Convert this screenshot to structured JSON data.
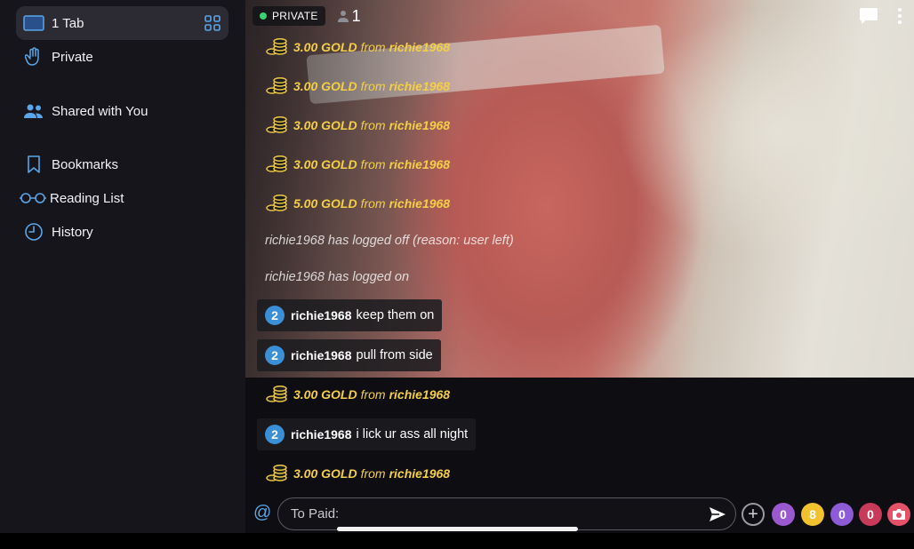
{
  "sidebar": {
    "items": [
      {
        "label": "1 Tab",
        "icon": "tab-overview-icon"
      },
      {
        "label": "Private",
        "icon": "hand-icon"
      },
      {
        "label": "Shared with You",
        "icon": "people-icon"
      },
      {
        "label": "Bookmarks",
        "icon": "bookmark-icon"
      },
      {
        "label": "Reading List",
        "icon": "glasses-icon"
      },
      {
        "label": "History",
        "icon": "clock-icon"
      }
    ]
  },
  "stream": {
    "mode_label": "PRIVATE",
    "viewer_count": "1"
  },
  "chat": {
    "messages": [
      {
        "type": "gold",
        "amount": "3.00 GOLD",
        "from": "from",
        "user": "richie1968"
      },
      {
        "type": "gold",
        "amount": "3.00 GOLD",
        "from": "from",
        "user": "richie1968"
      },
      {
        "type": "gold",
        "amount": "3.00 GOLD",
        "from": "from",
        "user": "richie1968"
      },
      {
        "type": "gold",
        "amount": "3.00 GOLD",
        "from": "from",
        "user": "richie1968"
      },
      {
        "type": "gold",
        "amount": "5.00 GOLD",
        "from": "from",
        "user": "richie1968"
      },
      {
        "type": "system",
        "text": "richie1968 has logged off (reason: user left)"
      },
      {
        "type": "system",
        "text": "richie1968 has logged on"
      },
      {
        "type": "user",
        "badge": "2",
        "user": "richie1968",
        "text": "keep them on"
      },
      {
        "type": "user",
        "badge": "2",
        "user": "richie1968",
        "text": "pull from side"
      },
      {
        "type": "gold",
        "amount": "3.00 GOLD",
        "from": "from",
        "user": "richie1968"
      },
      {
        "type": "user",
        "badge": "2",
        "user": "richie1968",
        "text": "i lick ur ass all night"
      },
      {
        "type": "gold",
        "amount": "3.00 GOLD",
        "from": "from",
        "user": "richie1968"
      }
    ]
  },
  "composer": {
    "at_symbol": "@",
    "placeholder": "To Paid:",
    "plus_label": "+",
    "counters": [
      {
        "value": "0",
        "color": "#9b59d0"
      },
      {
        "value": "8",
        "color": "#f2c12e"
      },
      {
        "value": "0",
        "color": "#8e5bd6"
      },
      {
        "value": "0",
        "color": "#c73a5a"
      }
    ]
  },
  "colors": {
    "gold_text": "#f4cf46",
    "badge_blue": "#3b8fd6",
    "accent_blue": "#5aa6e8",
    "online_green": "#3bd16f"
  }
}
